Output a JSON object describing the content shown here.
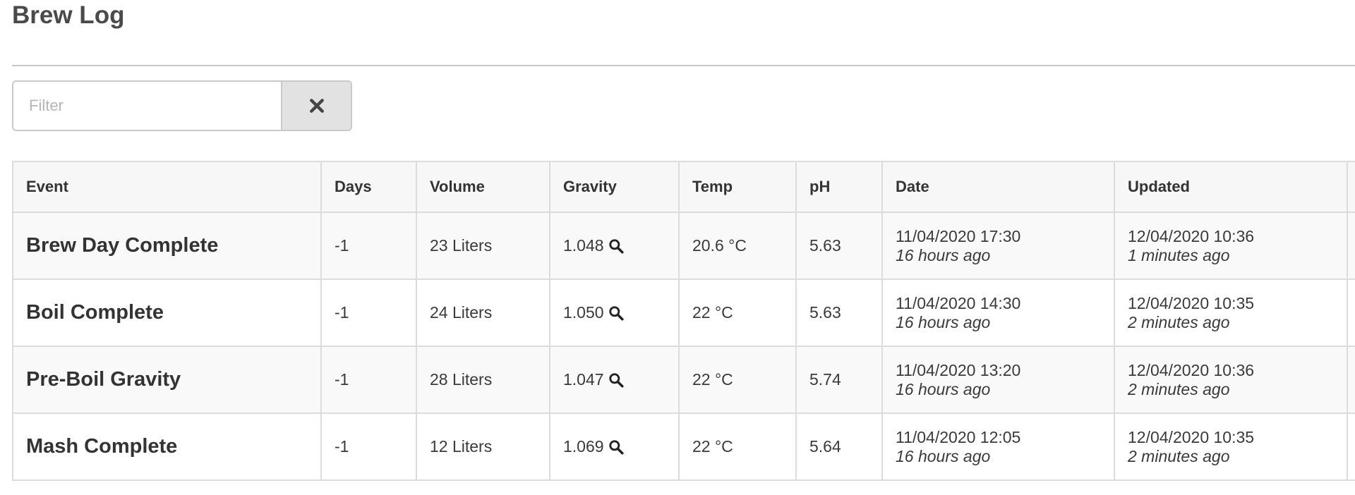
{
  "page": {
    "title": "Brew Log"
  },
  "filter": {
    "placeholder": "Filter",
    "value": "",
    "clear_icon": "times-icon"
  },
  "table": {
    "columns": [
      "Event",
      "Days",
      "Volume",
      "Gravity",
      "Temp",
      "pH",
      "Date",
      "Updated"
    ],
    "rows": [
      {
        "event": "Brew Day Complete",
        "days": "-1",
        "volume": "23 Liters",
        "gravity": "1.048",
        "temp": "20.6 °C",
        "ph": "5.63",
        "date": "11/04/2020 17:30",
        "date_ago": "16 hours ago",
        "updated": "12/04/2020 10:36",
        "updated_ago": "1 minutes ago"
      },
      {
        "event": "Boil Complete",
        "days": "-1",
        "volume": "24 Liters",
        "gravity": "1.050",
        "temp": "22 °C",
        "ph": "5.63",
        "date": "11/04/2020 14:30",
        "date_ago": "16 hours ago",
        "updated": "12/04/2020 10:35",
        "updated_ago": "2 minutes ago"
      },
      {
        "event": "Pre-Boil Gravity",
        "days": "-1",
        "volume": "28 Liters",
        "gravity": "1.047",
        "temp": "22 °C",
        "ph": "5.74",
        "date": "11/04/2020 13:20",
        "date_ago": "16 hours ago",
        "updated": "12/04/2020 10:36",
        "updated_ago": "2 minutes ago"
      },
      {
        "event": "Mash Complete",
        "days": "-1",
        "volume": "12 Liters",
        "gravity": "1.069",
        "temp": "22 °C",
        "ph": "5.64",
        "date": "11/04/2020 12:05",
        "date_ago": "16 hours ago",
        "updated": "12/04/2020 10:35",
        "updated_ago": "2 minutes ago"
      }
    ]
  },
  "icons": {
    "gravity_detail": "search-icon"
  }
}
